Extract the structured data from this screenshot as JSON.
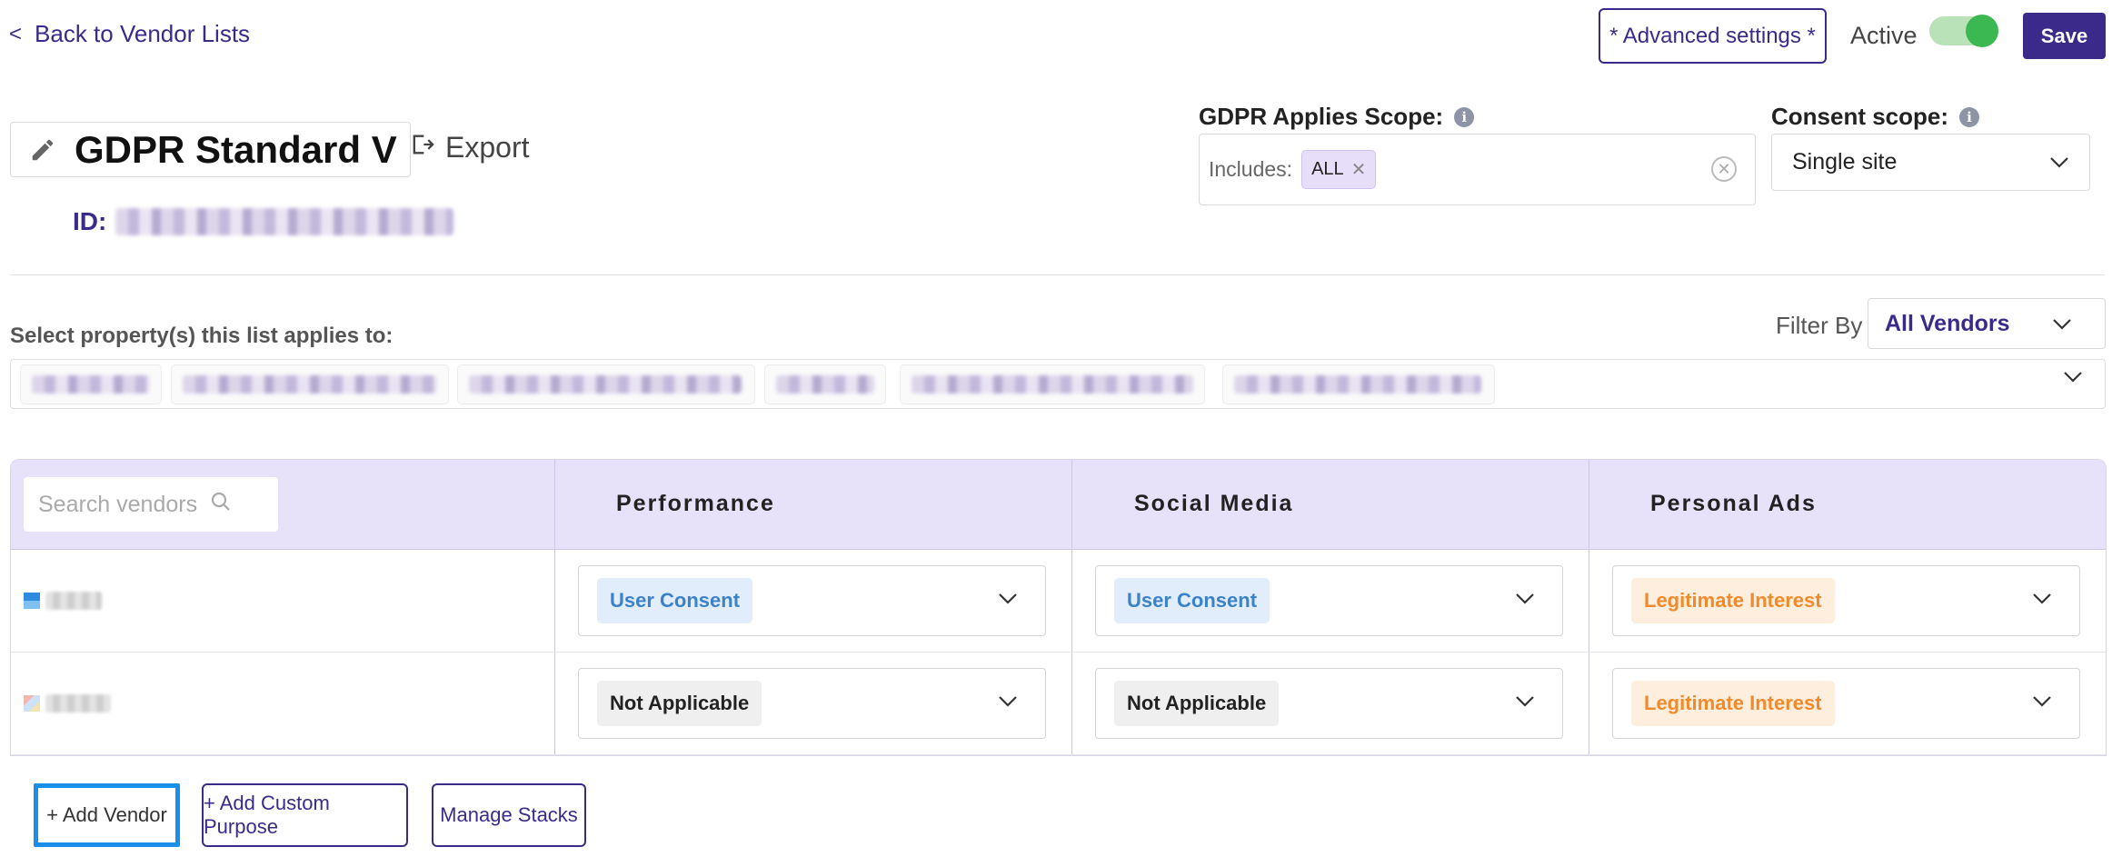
{
  "topbar": {
    "back_label": "Back to Vendor Lists",
    "advanced_label": "* Advanced settings *",
    "active_label": "Active",
    "active_on": true,
    "save_label": "Save"
  },
  "header": {
    "title": "GDPR Standard V",
    "export_label": "Export",
    "id_label": "ID:"
  },
  "gdpr_scope": {
    "label": "GDPR Applies Scope:",
    "includes_label": "Includes:",
    "chip": "ALL"
  },
  "consent_scope": {
    "label": "Consent scope:",
    "value": "Single site"
  },
  "properties": {
    "label": "Select property(s) this list applies to:",
    "filter_label": "Filter By",
    "filter_value": "All Vendors"
  },
  "table": {
    "search_placeholder": "Search vendors",
    "columns": [
      "Performance",
      "Social Media",
      "Personal Ads"
    ],
    "rows": [
      {
        "cells": [
          {
            "label": "User Consent",
            "kind": "consent"
          },
          {
            "label": "User Consent",
            "kind": "consent"
          },
          {
            "label": "Legitimate Interest",
            "kind": "legit"
          }
        ]
      },
      {
        "cells": [
          {
            "label": "Not Applicable",
            "kind": "na"
          },
          {
            "label": "Not Applicable",
            "kind": "na"
          },
          {
            "label": "Legitimate Interest",
            "kind": "legit"
          }
        ]
      }
    ]
  },
  "actions": {
    "add_vendor": "+ Add Vendor",
    "add_custom_purpose": "+ Add Custom Purpose",
    "manage_stacks": "Manage Stacks"
  },
  "colors": {
    "brand": "#3b2a8a",
    "toggle_on": "#3cb852",
    "header_bg": "#e8e1fa",
    "consent": "#3c82c8",
    "legit": "#f08a2a",
    "focus": "#1a8fe8"
  }
}
